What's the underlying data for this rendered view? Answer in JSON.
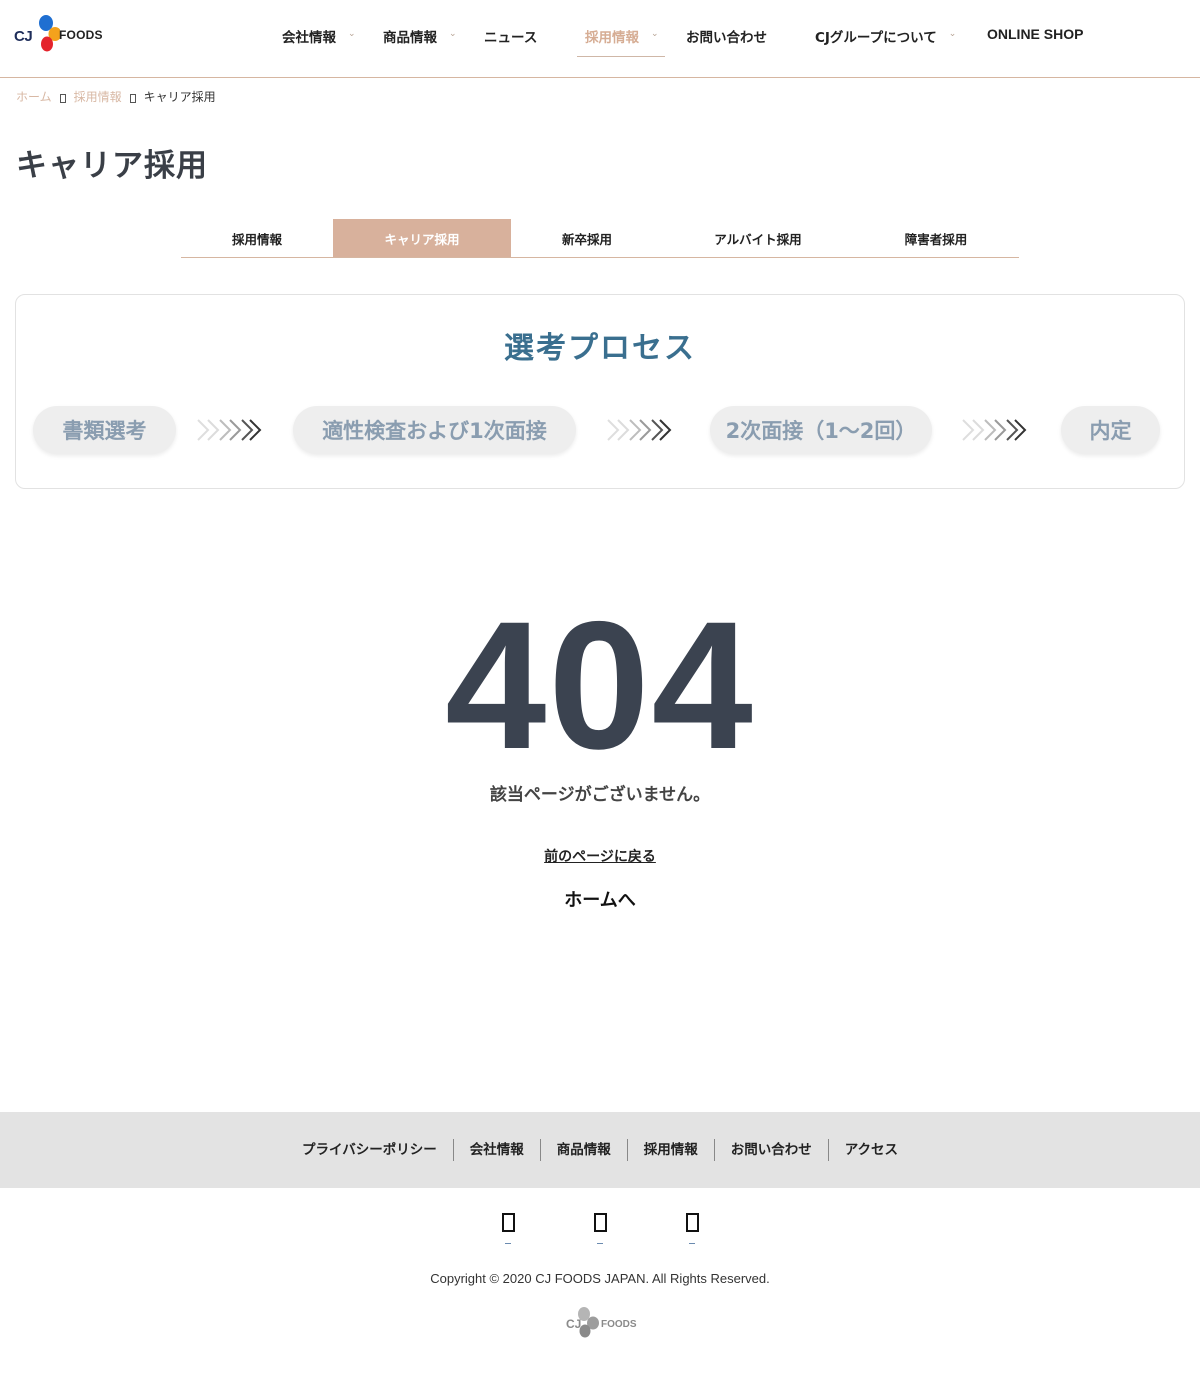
{
  "header": {
    "logo": {
      "brand": "CJ",
      "sub": "FOODS"
    },
    "nav": [
      {
        "label": "会社情報",
        "dropdown": true,
        "active": false
      },
      {
        "label": "商品情報",
        "dropdown": true,
        "active": false
      },
      {
        "label": "ニュース",
        "dropdown": false,
        "active": false
      },
      {
        "label": "採用情報",
        "dropdown": true,
        "active": true
      },
      {
        "label": "お問い合わせ",
        "dropdown": false,
        "active": false
      },
      {
        "label": "CJグループについて",
        "dropdown": true,
        "active": false
      },
      {
        "label": "ONLINE SHOP",
        "dropdown": false,
        "active": false
      }
    ]
  },
  "breadcrumb": {
    "home": "ホーム",
    "parent": "採用情報",
    "current": "キャリア採用"
  },
  "page_title": "キャリア採用",
  "tabs": [
    {
      "label": "採用情報",
      "active": false
    },
    {
      "label": "キャリア採用",
      "active": true
    },
    {
      "label": "新卒採用",
      "active": false
    },
    {
      "label": "アルバイト採用",
      "active": false
    },
    {
      "label": "障害者採用",
      "active": false
    }
  ],
  "process": {
    "title": "選考プロセス",
    "steps": [
      "書類選考",
      "適性検査および1次面接",
      "2次面接（1〜2回）",
      "内定"
    ]
  },
  "error": {
    "code": "404",
    "message": "該当ページがございません。",
    "back_label": "前のページに戻る",
    "home_label": "ホームへ"
  },
  "footer": {
    "links": [
      "プライバシーポリシー",
      "会社情報",
      "商品情報",
      "採用情報",
      "お問い合わせ",
      "アクセス"
    ],
    "social_icons": [
      "social-icon-1",
      "social-icon-2",
      "social-icon-3"
    ],
    "copyright": "Copyright © 2020 CJ FOODS JAPAN. All Rights Reserved.",
    "logo": {
      "brand": "CJ",
      "sub": "FOODS"
    }
  },
  "colors": {
    "accent": "#d8b19c",
    "accent_text": "#d6ad94",
    "process_title": "#3a6f8f",
    "step_text": "#8a9db0",
    "error_text": "#3b4350",
    "footer_bg": "#e3e3e3"
  }
}
